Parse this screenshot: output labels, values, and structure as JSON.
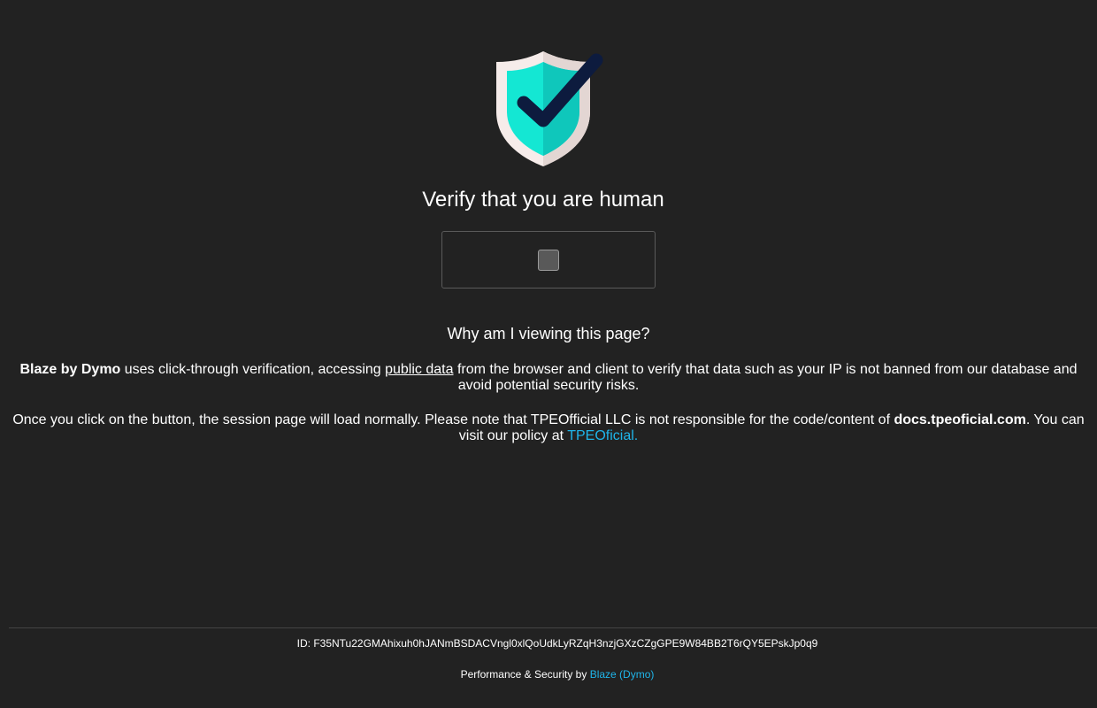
{
  "header": {
    "icon": "shield-check-icon",
    "title": "Verify that you are human"
  },
  "verification": {
    "checkbox_icon": "checkbox-icon"
  },
  "info": {
    "heading": "Why am I viewing this page?",
    "para1": {
      "brand": "Blaze by Dymo",
      "text_before_link": " uses click-through verification, accessing ",
      "link_text": "public data",
      "text_after_link": " from the browser and client to verify that data such as your IP is not banned from our database and avoid potential security risks."
    },
    "para2": {
      "text_before": "Once you click on the button, the session page will load normally. Please note that TPEOfficial LLC is not responsible for the code/content of ",
      "domain": "docs.tpeoficial.com",
      "text_middle": ". You can visit our policy at ",
      "link_text": "TPEOficial."
    }
  },
  "footer": {
    "id_line": "ID: F35NTu22GMAhixuh0hJANmBSDACVngl0xlQoUdkLyRZqH3nzjGXzCZgGPE9W84BB2T6rQY5EPskJp0q9",
    "performance_prefix": "Performance & Security by ",
    "performance_link": "Blaze (Dymo)"
  },
  "colors": {
    "background": "#222222",
    "link": "#1fb5ea",
    "shield_outer": "#f6ecea",
    "shield_inner": "#14e7d3",
    "check": "#0d1b3e"
  }
}
